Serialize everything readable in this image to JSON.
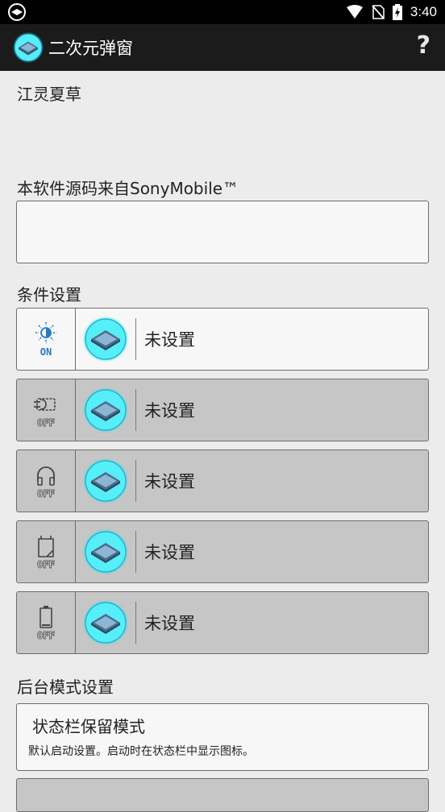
{
  "status_bar": {
    "time": "3:40"
  },
  "app_bar": {
    "title": "二次元弹窗",
    "help": "?"
  },
  "content": {
    "name_label": "江灵夏草",
    "source_label": "本软件源码来自SonyMobile™",
    "source_value": "",
    "conditions_label": "条件设置",
    "conditions": [
      {
        "icon": "brightness-icon",
        "state": "ON",
        "value": "未设置"
      },
      {
        "icon": "charger-plug-icon",
        "state": "OFF",
        "value": "未设置"
      },
      {
        "icon": "headphones-icon",
        "state": "OFF",
        "value": "未设置"
      },
      {
        "icon": "sd-card-icon",
        "state": "OFF",
        "value": "未设置"
      },
      {
        "icon": "battery-icon",
        "state": "OFF",
        "value": "未设置"
      }
    ],
    "background_mode_label": "后台模式设置",
    "modes": [
      {
        "title": "状态栏保留模式",
        "desc": "默认启动设置。启动时在状态栏中显示图标。"
      }
    ]
  },
  "colors": {
    "accent": "#2878c8",
    "app_bar": "#1b1b1b",
    "disabled_row": "#c6c6c6",
    "glow": "#33e6f0"
  }
}
